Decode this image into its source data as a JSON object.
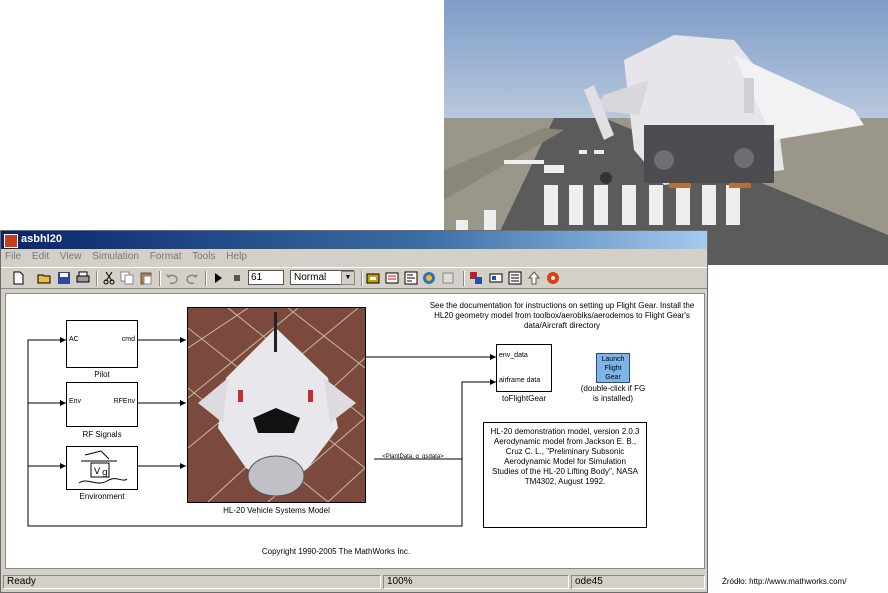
{
  "window": {
    "title": "asbhl20"
  },
  "menu": [
    "File",
    "Edit",
    "View",
    "Simulation",
    "Format",
    "Tools",
    "Help"
  ],
  "toolbar": {
    "stop_time": "61",
    "solver_mode": "Normal"
  },
  "blocks": {
    "pilot": {
      "label": "Pilot",
      "in_port": "AC",
      "out_port": "cmd"
    },
    "rf_signals": {
      "label": "RF Signals",
      "in_port": "Env",
      "out_port": "RFEnv"
    },
    "environment": {
      "label": "Environment"
    },
    "vehicle": {
      "label": "HL-20 Vehicle Systems Model"
    },
    "to_flightgear": {
      "label": "toFlightGear",
      "in_ports": [
        "env_data",
        "airframe data"
      ]
    },
    "launch": {
      "text": "Launch Flight Gear",
      "caption": "(double-click if FG is installed)"
    }
  },
  "signals": {
    "plant_data": "<PlantData, g_gsdata>"
  },
  "notes": {
    "instructions": "See the documentation for instructions on setting up Flight Gear. Install the HL20 geometry model from toolbox/aeroblks/aerodemos to Flight Gear's data/Aircraft directory",
    "model_info": "HL-20 demonstration model, version 2.0.3 Aerodynamic model from Jackson E. B., Cruz C. L., \"Preliminary Subsonic Aerodynamic Model for Simulation Studies of the HL-20 Lifting Body\", NASA TM4302, August 1992.",
    "copyright": "Copyright 1990-2005 The MathWorks Inc."
  },
  "status": {
    "state": "Ready",
    "zoom": "100%",
    "solver": "ode45"
  },
  "source": "Źródło:  http://www.mathworks.com/"
}
